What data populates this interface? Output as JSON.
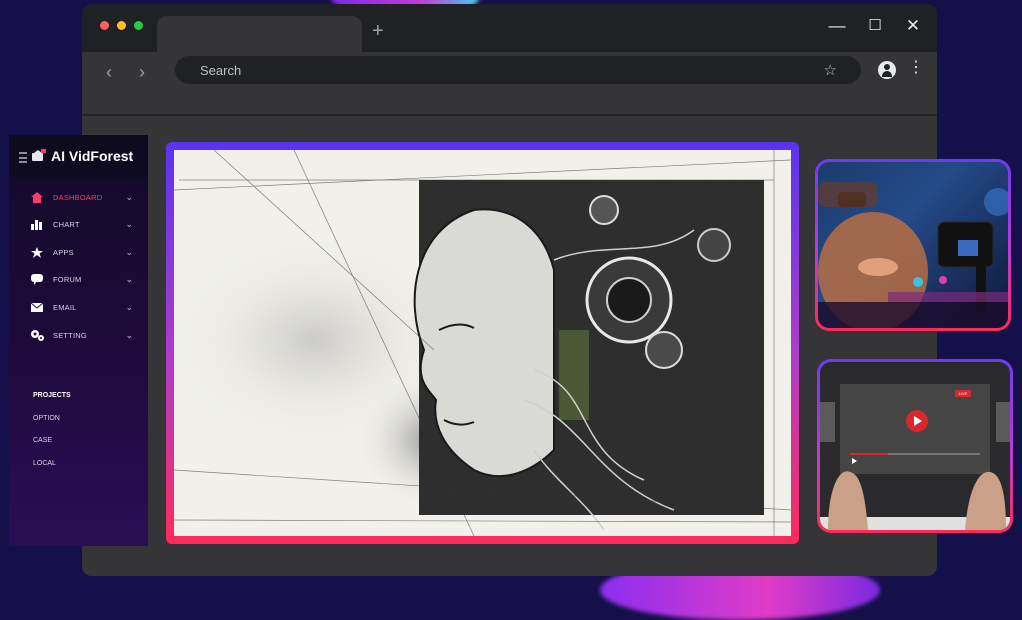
{
  "browser": {
    "window_controls": {
      "traffic_lights": [
        "#ff5f57",
        "#febc2e",
        "#28c840"
      ],
      "minimize": "—",
      "maximize": "☐",
      "close": "✕"
    },
    "new_tab": "+",
    "back": "‹",
    "forward": "›",
    "search_placeholder": "Search",
    "star": "☆",
    "menu": "⋮"
  },
  "sidebar": {
    "logo": "AI VidForest",
    "menu": [
      {
        "label": "DASHBOARD",
        "icon": "home-icon",
        "active": true,
        "chevron": "⌄"
      },
      {
        "label": "CHART",
        "icon": "bar-chart-icon",
        "active": false,
        "chevron": "⌄"
      },
      {
        "label": "APPS",
        "icon": "star-icon",
        "active": false,
        "chevron": "⌄"
      },
      {
        "label": "FORUM",
        "icon": "chat-bubble-icon",
        "active": false,
        "chevron": "⌄"
      },
      {
        "label": "EMAIL",
        "icon": "envelope-icon",
        "active": false,
        "chevron": "⌄"
      },
      {
        "label": "SETTING",
        "icon": "gears-icon",
        "active": false,
        "chevron": "⌄"
      }
    ],
    "section_title": "PROJECTS",
    "sub_items": [
      "OPTION",
      "CASE",
      "LOCAL"
    ]
  },
  "thumbnails": {
    "video_live_badge": "LIVE"
  },
  "colors": {
    "accent_active": "#ff3a66",
    "frame_gradient_top": "#5a34f0",
    "frame_gradient_bottom": "#ff2a5a"
  }
}
